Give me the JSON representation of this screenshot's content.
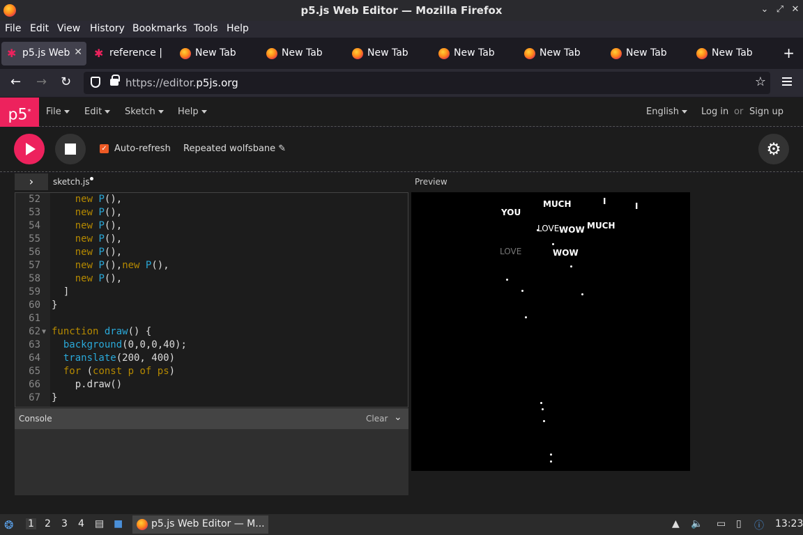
{
  "window": {
    "title": "p5.js Web Editor — Mozilla Firefox"
  },
  "menubar": [
    "File",
    "Edit",
    "View",
    "History",
    "Bookmarks",
    "Tools",
    "Help"
  ],
  "tabs": [
    {
      "label": "p5.js Web",
      "icon": "p5-star-icon"
    },
    {
      "label": "reference |",
      "icon": "p5-star-icon"
    },
    {
      "label": "New Tab",
      "icon": "firefox-icon"
    },
    {
      "label": "New Tab",
      "icon": "firefox-icon"
    },
    {
      "label": "New Tab",
      "icon": "firefox-icon"
    },
    {
      "label": "New Tab",
      "icon": "firefox-icon"
    },
    {
      "label": "New Tab",
      "icon": "firefox-icon"
    },
    {
      "label": "New Tab",
      "icon": "firefox-icon"
    },
    {
      "label": "New Tab",
      "icon": "firefox-icon"
    }
  ],
  "url": {
    "prefix": "https://editor.",
    "domain": "p5js.org"
  },
  "p5": {
    "logo": "p5",
    "logo_sup": "*",
    "menus": [
      "File",
      "Edit",
      "Sketch",
      "Help"
    ],
    "language": "English",
    "login": "Log in",
    "or": "or",
    "signup": "Sign up",
    "auto_refresh": "Auto-refresh",
    "sketch_name": "Repeated wolfsbane",
    "file_tab": "sketch.js",
    "preview_label": "Preview",
    "console_title": "Console",
    "console_clear": "Clear"
  },
  "code_lines": [
    {
      "n": "52",
      "text": "    new P(),"
    },
    {
      "n": "53",
      "text": "    new P(),"
    },
    {
      "n": "54",
      "text": "    new P(),"
    },
    {
      "n": "55",
      "text": "    new P(),"
    },
    {
      "n": "56",
      "text": "    new P(),"
    },
    {
      "n": "57",
      "text": "    new P(),new P(),"
    },
    {
      "n": "58",
      "text": "    new P(),"
    },
    {
      "n": "59",
      "text": "  ]"
    },
    {
      "n": "60",
      "text": "}"
    },
    {
      "n": "61",
      "text": ""
    },
    {
      "n": "62",
      "text": "function draw() {"
    },
    {
      "n": "63",
      "text": "  background(0,0,0,40);"
    },
    {
      "n": "64",
      "text": "  translate(200, 400)"
    },
    {
      "n": "65",
      "text": "  for (const p of ps)"
    },
    {
      "n": "66",
      "text": "    p.draw()"
    },
    {
      "n": "67",
      "text": "}"
    }
  ],
  "canvas_words": [
    {
      "text": "YOU",
      "dim": false
    },
    {
      "text": "MUCH",
      "dim": false
    },
    {
      "text": "I",
      "dim": false
    },
    {
      "text": "I",
      "dim": false
    },
    {
      "text": "LOVE",
      "dim": false
    },
    {
      "text": "WOW",
      "dim": false
    },
    {
      "text": "MUCH",
      "dim": false
    },
    {
      "text": "LOVE",
      "dim": true
    },
    {
      "text": "WOW",
      "dim": false
    }
  ],
  "taskbar": {
    "workspaces": [
      "1",
      "2",
      "3",
      "4"
    ],
    "window_label": "p5.js Web Editor — M...",
    "clock": "13:23"
  }
}
